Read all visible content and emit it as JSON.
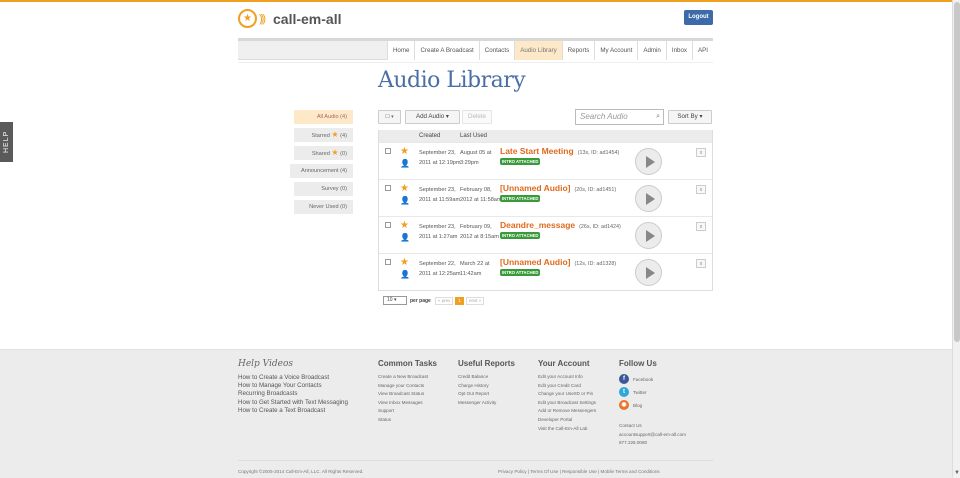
{
  "header": {
    "logo_text": "call-em-all",
    "logout": "Logout",
    "nav": [
      "Home",
      "Create A Broadcast",
      "Contacts",
      "Audio Library",
      "Reports",
      "My Account",
      "Admin",
      "Inbox",
      "API"
    ]
  },
  "help_tab": "HELP",
  "page_title": "Audio Library",
  "sidebar": {
    "all": "All Audio (4)",
    "starred": "Starred",
    "starred_count": "(4)",
    "shared": "Shared",
    "shared_count": "(0)",
    "announcement": "Announcement (4)",
    "survey": "Survey (0)",
    "never_used": "Never Used (0)"
  },
  "toolbar": {
    "select_caret": "▾",
    "add_audio": "Add Audio",
    "delete": "Delete",
    "search_placeholder": "Search Audio",
    "sort_by": "Sort By"
  },
  "table": {
    "headers": {
      "created": "Created",
      "last_used": "Last Used"
    },
    "badge": "INTRO ATTACHED",
    "delete_x": "x",
    "rows": [
      {
        "created": "September 23, 2011 at 12:19pm",
        "last_used": "August 05 at 3:29pm",
        "name": "Late Start Meeting",
        "meta": "(13s, ID: ad1454)"
      },
      {
        "created": "September 23, 2011 at 11:59am",
        "last_used": "February 08, 2012 at 11:58am",
        "name": "[Unnamed Audio]",
        "meta": "(20s, ID: ad1451)"
      },
      {
        "created": "September 23, 2011 at 1:27am",
        "last_used": "February 09, 2012 at 8:15am",
        "name": "Deandre_message",
        "meta": "(26s, ID: ad1424)"
      },
      {
        "created": "September 22, 2011 at 12:25am",
        "last_used": "March 22 at 11:42am",
        "name": "[Unnamed Audio]",
        "meta": "(12s, ID: ad1328)"
      }
    ]
  },
  "pager": {
    "per_page_value": "10",
    "per_page_label": "per page",
    "prev": "« prev",
    "current": "1",
    "next": "next »"
  },
  "footer": {
    "help_videos": {
      "title": "Help Videos",
      "links": [
        "How to Create a Voice Broadcast",
        "How to Manage Your Contacts",
        "Recurring Broadcasts",
        "How to Get Started with Text Messaging",
        "How to Create a Text Broadcast"
      ]
    },
    "common_tasks": {
      "title": "Common Tasks",
      "links": [
        "Create a New Broadcast",
        "Manage your Contacts",
        "View Broadcast Status",
        "View Inbox Messages",
        "Support",
        "Status"
      ]
    },
    "useful_reports": {
      "title": "Useful Reports",
      "links": [
        "Credit Balance",
        "Charge History",
        "Opt Out Report",
        "Messenger Activity"
      ]
    },
    "your_account": {
      "title": "Your Account",
      "links": [
        "Edit your Account Info",
        "Edit your Credit Card",
        "Change your UserID or Pin",
        "Edit your Broadcast Settings",
        "Add or Remove Messengers",
        "Developer Portal",
        "Visit the Call-Em-All Lab"
      ]
    },
    "follow_us": {
      "title": "Follow Us",
      "facebook": "Facebook",
      "twitter": "Twitter",
      "blog": "Blog",
      "contact_us": "Contact Us",
      "email": "accountsupport@call-em-all.com",
      "phone": "877.228.0080"
    },
    "copyright": "Copyright ©2005-2014 Call-Em-All, LLC. All Rights Reserved.",
    "legal": "Privacy Policy | Terms Of Use | Responsible Use | Mobile Terms and Conditions"
  }
}
